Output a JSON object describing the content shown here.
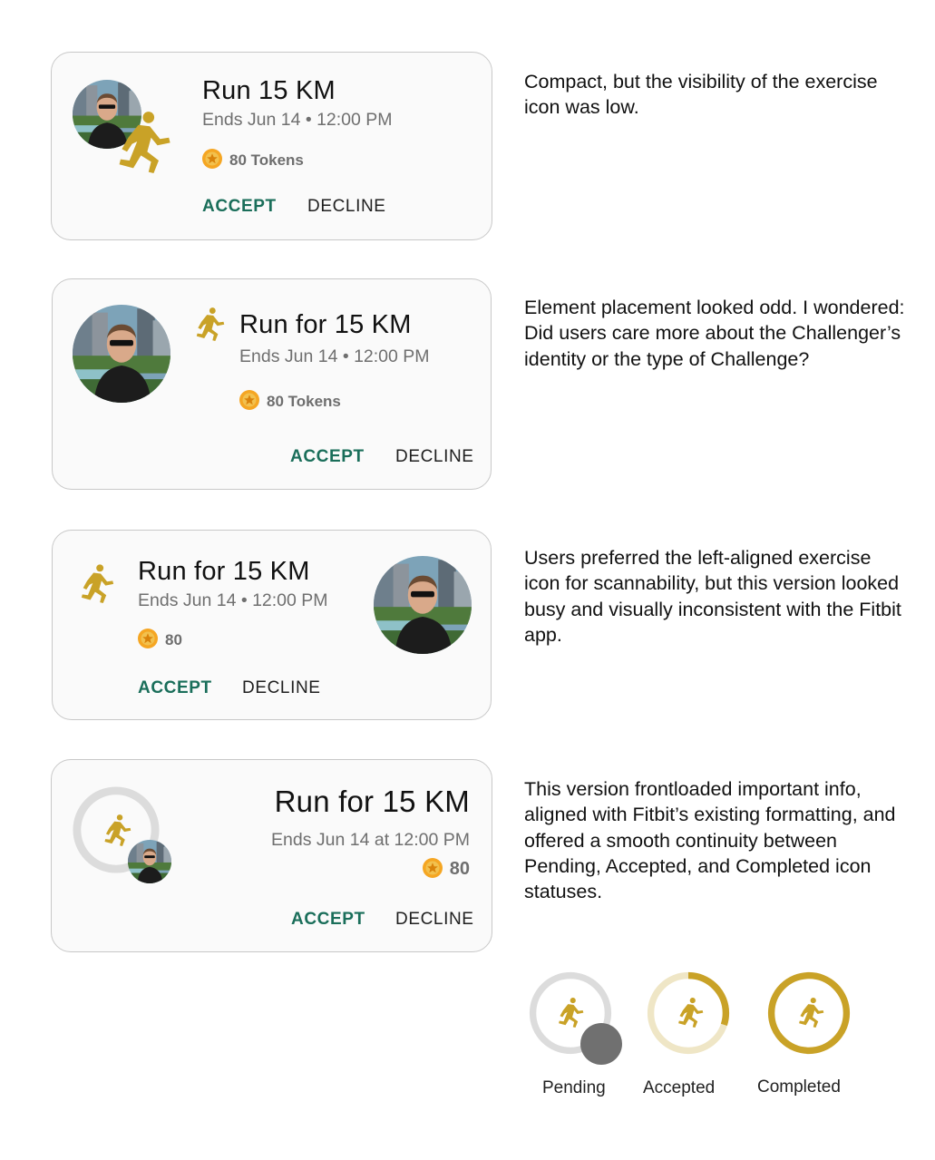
{
  "colors": {
    "accent_gold": "#c9a227",
    "accept_green": "#1a6e5a",
    "ring_grey": "#dcdcdc",
    "ring_light_gold": "#efe6c6"
  },
  "icons": {
    "exercise": "running-person-icon",
    "token": "star-coin-icon",
    "challenger": "avatar-photo"
  },
  "options": [
    {
      "title": "Run 15 KM",
      "subtitle": "Ends Jun 14 • 12:00 PM",
      "tokens": "80 Tokens",
      "accept": "ACCEPT",
      "decline": "DECLINE",
      "note": "Compact, but the visibility of the exercise icon was low."
    },
    {
      "title": "Run for 15 KM",
      "subtitle": "Ends Jun 14 • 12:00 PM",
      "tokens": "80 Tokens",
      "accept": "ACCEPT",
      "decline": "DECLINE",
      "note": "Element placement looked odd. I wondered: Did users care more about the Challenger’s identity or the type of Challenge?"
    },
    {
      "title": "Run for 15 KM",
      "subtitle": "Ends Jun 14 • 12:00 PM",
      "tokens": "80",
      "accept": "ACCEPT",
      "decline": "DECLINE",
      "note": "Users preferred the left-aligned exercise icon for scannability, but this version looked busy and visually inconsistent with the Fitbit app."
    },
    {
      "title": "Run for 15 KM",
      "subtitle": "Ends Jun 14 at 12:00 PM",
      "tokens": "80",
      "accept": "ACCEPT",
      "decline": "DECLINE",
      "note": "This version frontloaded important info, aligned with Fitbit’s existing formatting, and offered a smooth continuity between Pending, Accepted, and Completed icon statuses."
    }
  ],
  "statuses": [
    {
      "label": "Pending",
      "progress": 0
    },
    {
      "label": "Accepted",
      "progress": 0.3
    },
    {
      "label": "Completed",
      "progress": 1
    }
  ]
}
